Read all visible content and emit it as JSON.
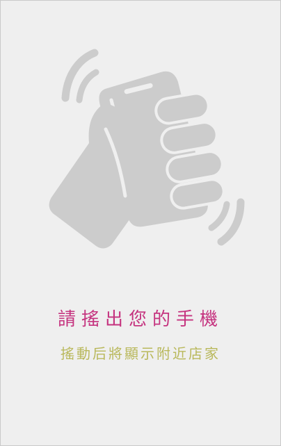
{
  "shake": {
    "illustration_icon": "hand-shaking-phone-icon",
    "prompt": "請搖出您的手機",
    "hint": "搖動后將顯示附近店家"
  },
  "colors": {
    "background": "#efefef",
    "illustration": "#cccccc",
    "prompt": "#c5337f",
    "hint": "#b9b85b"
  }
}
